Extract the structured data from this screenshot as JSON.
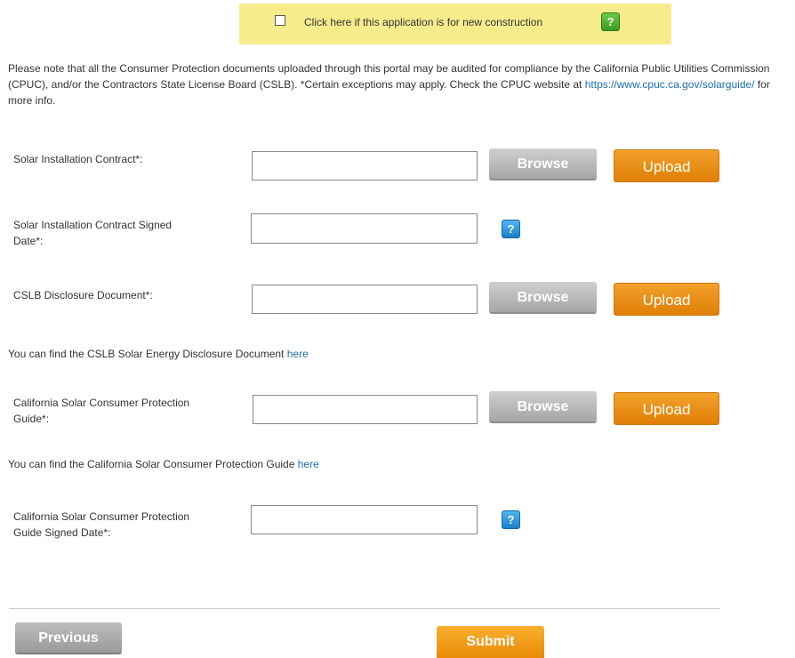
{
  "banner": {
    "new_construction_label": "Click here if this application is for new construction",
    "help_glyph": "?"
  },
  "notice": {
    "text_before_link": "Please note that all the Consumer Protection documents uploaded through this portal may be audited for compliance by the California Public Utilities Commission (CPUC), and/or the Contractors State License Board (CSLB). *Certain exceptions may apply. Check the CPUC website at ",
    "link_text": "https://www.cpuc.ca.gov/solarguide/",
    "text_after_link": " for more info."
  },
  "fields": {
    "contract_label": "Solar Installation Contract*:",
    "contract_value": "",
    "contract_date_label_1": "Solar Installation Contract Signed",
    "contract_date_label_2": "Date*:",
    "contract_date_value": "",
    "cslb_label": "CSLB Disclosure Document*:",
    "cslb_value": "",
    "guide_label_1": "California Solar Consumer Protection",
    "guide_label_2": "Guide*:",
    "guide_value": "",
    "guide_date_label_1": "California Solar Consumer Protection",
    "guide_date_label_2": "Guide Signed Date*:",
    "guide_date_value": ""
  },
  "info": {
    "cslb_text": "You can find the CSLB Solar Energy Disclosure Document ",
    "guide_text": "You can find the California Solar Consumer Protection Guide ",
    "here_link": "here"
  },
  "buttons": {
    "browse": "Browse",
    "upload": "Upload",
    "previous": "Previous",
    "submit": "Submit",
    "help_glyph": "?"
  },
  "colors": {
    "banner_bg": "#f7ec8c",
    "upload_orange": "#e8890a",
    "browse_gray": "#b8b8b8",
    "link_blue": "#1a6fb5",
    "help_green": "#4caf2a",
    "help_blue": "#2a8fd8"
  },
  "icons": {
    "help_green": "question-help-icon",
    "help_blue": "question-help-icon"
  }
}
